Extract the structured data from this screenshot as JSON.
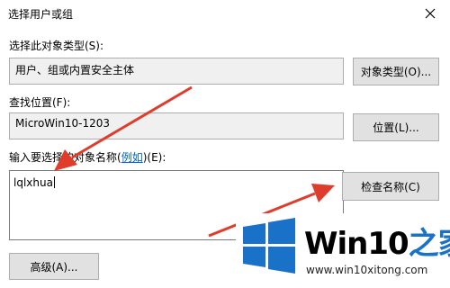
{
  "dialog": {
    "title": "选择用户或组",
    "close_symbol": "×"
  },
  "object_type": {
    "label": "选择此对象类型(S):",
    "value": "用户、组或内置安全主体",
    "button": "对象类型(O)..."
  },
  "location": {
    "label": "查找位置(F):",
    "value": "MicroWin10-1203",
    "button": "位置(L)..."
  },
  "names": {
    "label_prefix": "输入要选择的对象名称(",
    "example_link": "例如",
    "label_suffix": ")(E):",
    "value": "lqlxhua",
    "check_button": "检查名称(C)"
  },
  "advanced_button": "高级(A)...",
  "watermark": {
    "brand_main": "Win10",
    "brand_cn": "之家",
    "url": "www.win10xitong.com"
  },
  "colors": {
    "arrow": "#e03c2c",
    "logo_blue": "#1a72c8"
  }
}
